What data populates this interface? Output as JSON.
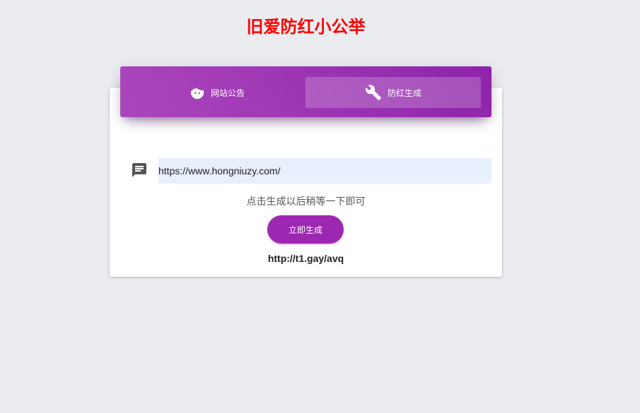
{
  "site": {
    "title": "旧爱防红小公举"
  },
  "tabs": [
    {
      "label": "网站公告",
      "icon": "face-icon"
    },
    {
      "label": "防红生成",
      "icon": "wrench-icon",
      "active": true
    }
  ],
  "form": {
    "url_value": "https://www.hongniuzy.com/",
    "input_icon": "chat-icon",
    "hint": "点击生成以后稍等一下即可",
    "button_label": "立即生成",
    "result_link": "http://t1.gay/avq"
  },
  "colors": {
    "title": "#ff0000",
    "accent": "#9c27b0",
    "tab_gradient_start": "#ab47bc",
    "tab_gradient_end": "#8e24aa",
    "input_background": "#e8f0fe",
    "page_background": "#ebecf0"
  }
}
